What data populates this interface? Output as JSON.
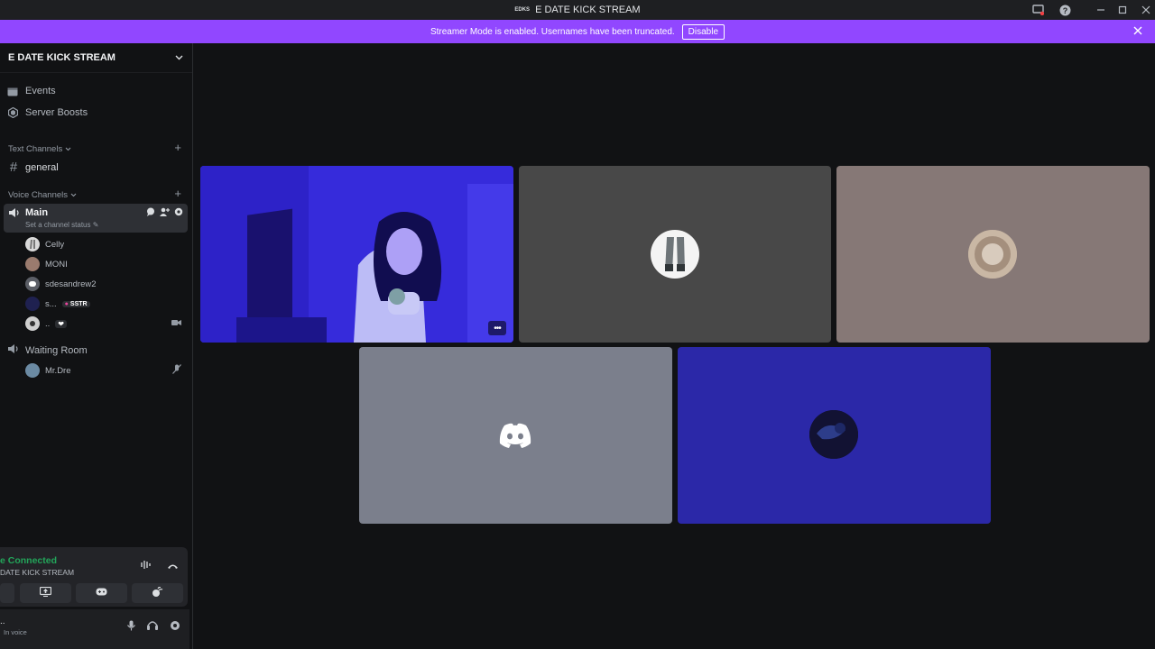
{
  "window": {
    "title": "E DATE KICK STREAM",
    "server_short": "EDKS"
  },
  "banner": {
    "message": "Streamer Mode is enabled. Usernames have been truncated.",
    "disable_label": "Disable"
  },
  "sidebar": {
    "server_name": "E DATE KICK STREAM",
    "top_items": [
      {
        "label": "Events",
        "icon": "calendar-icon"
      },
      {
        "label": "Server Boosts",
        "icon": "boost-icon"
      }
    ],
    "text_category": "Text Channels",
    "text_channels": [
      {
        "label": "general"
      }
    ],
    "voice_category": "Voice Channels",
    "main_channel": {
      "label": "Main",
      "status_placeholder": "Set a channel status"
    },
    "main_users": [
      {
        "name": "Celly",
        "color": "#d9d9d9"
      },
      {
        "name": "MONI",
        "color": "#9a7b6e"
      },
      {
        "name": "sdesandrew2",
        "color": "#5865f2"
      },
      {
        "name": "s...",
        "color": "#3a3f8f",
        "tag": "SSTR",
        "tag_color": "#eb459e"
      },
      {
        "name": "..",
        "color": "#cfcfcf",
        "has_heart": true
      }
    ],
    "waiting_room": {
      "label": "Waiting Room",
      "users": [
        {
          "name": "Mr.Dre",
          "color": "#6b8aa3"
        }
      ]
    }
  },
  "voice_panel": {
    "status": "e Connected",
    "server": "DATE KICK STREAM"
  },
  "user_panel": {
    "name": "..",
    "sub": "In voice"
  },
  "tiles": [
    {
      "name": "video-stream",
      "bg": "#3d2fd9"
    },
    {
      "name": "participant-2",
      "bg": "#484848"
    },
    {
      "name": "participant-3",
      "bg": "#867876"
    },
    {
      "name": "participant-4",
      "bg": "#7b7f8c"
    },
    {
      "name": "participant-5",
      "bg": "#2b28a8"
    }
  ]
}
